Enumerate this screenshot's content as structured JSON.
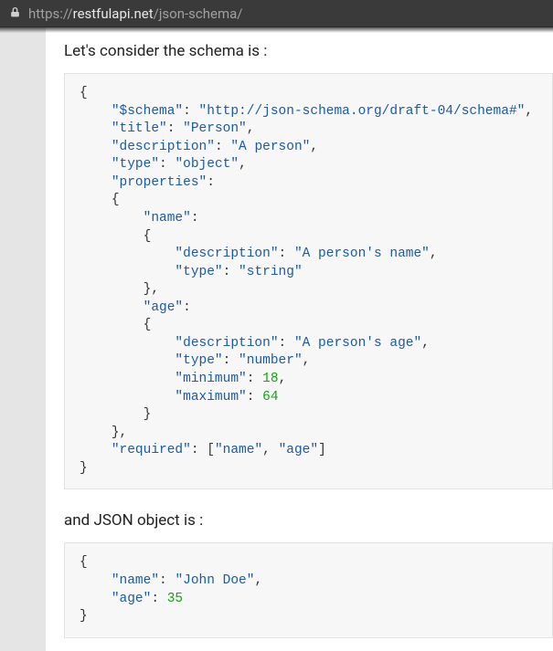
{
  "address": {
    "scheme": "https://",
    "domain": "restfulapi.net",
    "path": "/json-schema/"
  },
  "text": {
    "intro": "Let's consider the schema is :",
    "middle": "and JSON object is :"
  },
  "schema_code": {
    "lines": [
      {
        "indent": 0,
        "tokens": [
          {
            "t": "{",
            "c": "brace"
          }
        ]
      },
      {
        "indent": 1,
        "tokens": [
          {
            "t": "\"$schema\"",
            "c": "key"
          },
          {
            "t": ": ",
            "c": "punct"
          },
          {
            "t": "\"http://json-schema.org/draft-04/schema#\"",
            "c": "str"
          },
          {
            "t": ",",
            "c": "punct"
          }
        ]
      },
      {
        "indent": 1,
        "tokens": [
          {
            "t": "\"title\"",
            "c": "key"
          },
          {
            "t": ": ",
            "c": "punct"
          },
          {
            "t": "\"Person\"",
            "c": "str"
          },
          {
            "t": ",",
            "c": "punct"
          }
        ]
      },
      {
        "indent": 1,
        "tokens": [
          {
            "t": "\"description\"",
            "c": "key"
          },
          {
            "t": ": ",
            "c": "punct"
          },
          {
            "t": "\"A person\"",
            "c": "str"
          },
          {
            "t": ",",
            "c": "punct"
          }
        ]
      },
      {
        "indent": 1,
        "tokens": [
          {
            "t": "\"type\"",
            "c": "key"
          },
          {
            "t": ": ",
            "c": "punct"
          },
          {
            "t": "\"object\"",
            "c": "str"
          },
          {
            "t": ",",
            "c": "punct"
          }
        ]
      },
      {
        "indent": 1,
        "tokens": [
          {
            "t": "\"properties\"",
            "c": "key"
          },
          {
            "t": ":",
            "c": "punct"
          }
        ]
      },
      {
        "indent": 1,
        "tokens": [
          {
            "t": "{",
            "c": "brace"
          }
        ]
      },
      {
        "indent": 2,
        "tokens": [
          {
            "t": "\"name\"",
            "c": "key"
          },
          {
            "t": ":",
            "c": "punct"
          }
        ]
      },
      {
        "indent": 2,
        "tokens": [
          {
            "t": "{",
            "c": "brace"
          }
        ]
      },
      {
        "indent": 3,
        "tokens": [
          {
            "t": "\"description\"",
            "c": "key"
          },
          {
            "t": ": ",
            "c": "punct"
          },
          {
            "t": "\"A person's name\"",
            "c": "str"
          },
          {
            "t": ",",
            "c": "punct"
          }
        ]
      },
      {
        "indent": 3,
        "tokens": [
          {
            "t": "\"type\"",
            "c": "key"
          },
          {
            "t": ": ",
            "c": "punct"
          },
          {
            "t": "\"string\"",
            "c": "str"
          }
        ]
      },
      {
        "indent": 2,
        "tokens": [
          {
            "t": "},",
            "c": "brace"
          }
        ]
      },
      {
        "indent": 2,
        "tokens": [
          {
            "t": "\"age\"",
            "c": "key"
          },
          {
            "t": ":",
            "c": "punct"
          }
        ]
      },
      {
        "indent": 2,
        "tokens": [
          {
            "t": "{",
            "c": "brace"
          }
        ]
      },
      {
        "indent": 3,
        "tokens": [
          {
            "t": "\"description\"",
            "c": "key"
          },
          {
            "t": ": ",
            "c": "punct"
          },
          {
            "t": "\"A person's age\"",
            "c": "str"
          },
          {
            "t": ",",
            "c": "punct"
          }
        ]
      },
      {
        "indent": 3,
        "tokens": [
          {
            "t": "\"type\"",
            "c": "key"
          },
          {
            "t": ": ",
            "c": "punct"
          },
          {
            "t": "\"number\"",
            "c": "str"
          },
          {
            "t": ",",
            "c": "punct"
          }
        ]
      },
      {
        "indent": 3,
        "tokens": [
          {
            "t": "\"minimum\"",
            "c": "key"
          },
          {
            "t": ": ",
            "c": "punct"
          },
          {
            "t": "18",
            "c": "num"
          },
          {
            "t": ",",
            "c": "punct"
          }
        ]
      },
      {
        "indent": 3,
        "tokens": [
          {
            "t": "\"maximum\"",
            "c": "key"
          },
          {
            "t": ": ",
            "c": "punct"
          },
          {
            "t": "64",
            "c": "num"
          }
        ]
      },
      {
        "indent": 2,
        "tokens": [
          {
            "t": "}",
            "c": "brace"
          }
        ]
      },
      {
        "indent": 1,
        "tokens": [
          {
            "t": "},",
            "c": "brace"
          }
        ]
      },
      {
        "indent": 1,
        "tokens": [
          {
            "t": "\"required\"",
            "c": "key"
          },
          {
            "t": ": [",
            "c": "punct"
          },
          {
            "t": "\"name\"",
            "c": "str"
          },
          {
            "t": ", ",
            "c": "punct"
          },
          {
            "t": "\"age\"",
            "c": "str"
          },
          {
            "t": "]",
            "c": "punct"
          }
        ]
      },
      {
        "indent": 0,
        "tokens": [
          {
            "t": "}",
            "c": "brace"
          }
        ]
      }
    ]
  },
  "object_code": {
    "lines": [
      {
        "indent": 0,
        "tokens": [
          {
            "t": "{",
            "c": "brace"
          }
        ]
      },
      {
        "indent": 1,
        "tokens": [
          {
            "t": "\"name\"",
            "c": "key"
          },
          {
            "t": ": ",
            "c": "punct"
          },
          {
            "t": "\"John Doe\"",
            "c": "str"
          },
          {
            "t": ",",
            "c": "punct"
          }
        ]
      },
      {
        "indent": 1,
        "tokens": [
          {
            "t": "\"age\"",
            "c": "key"
          },
          {
            "t": ": ",
            "c": "punct"
          },
          {
            "t": "35",
            "c": "num"
          }
        ]
      },
      {
        "indent": 0,
        "tokens": [
          {
            "t": "}",
            "c": "brace"
          }
        ]
      }
    ]
  }
}
